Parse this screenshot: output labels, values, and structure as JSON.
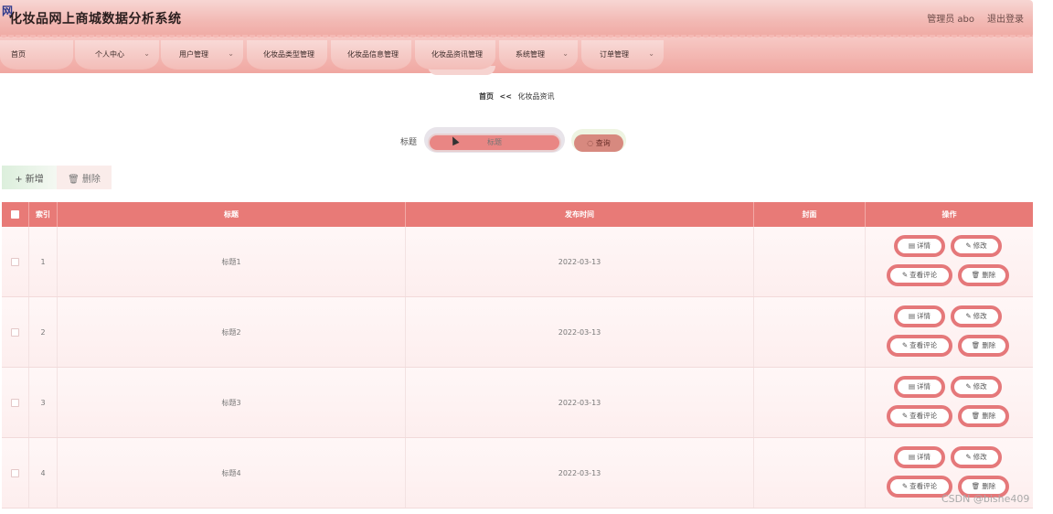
{
  "app": {
    "logo_glyph": "网",
    "title": "化妆品网上商城数据分析系统",
    "user_label": "管理员 abo",
    "logout_label": "退出登录"
  },
  "nav": {
    "items": [
      {
        "label": "首页",
        "has_dropdown": false
      },
      {
        "label": "个人中心",
        "has_dropdown": true
      },
      {
        "label": "用户管理",
        "has_dropdown": true
      },
      {
        "label": "化妆品类型管理",
        "has_dropdown": false
      },
      {
        "label": "化妆品信息管理",
        "has_dropdown": false
      },
      {
        "label": "化妆品资讯管理",
        "has_dropdown": false,
        "active": true
      },
      {
        "label": "系统管理",
        "has_dropdown": true
      },
      {
        "label": "订单管理",
        "has_dropdown": true
      }
    ],
    "dropdown_glyph": "⌄"
  },
  "breadcrumb": {
    "home": "首页",
    "separator": "<<",
    "current": "化妆品资讯"
  },
  "search": {
    "label": "标题",
    "placeholder": "标题",
    "value": "",
    "button_label": "◌ 查询"
  },
  "toolbar": {
    "add_label": "+ 新增",
    "delete_label": "🗑 删除"
  },
  "table": {
    "headers": [
      "",
      "索引",
      "标题",
      "发布时间",
      "封面",
      "操作"
    ],
    "rows": [
      {
        "index": "1",
        "title": "标题1",
        "date": "2022-03-13",
        "cover": ""
      },
      {
        "index": "2",
        "title": "标题2",
        "date": "2022-03-13",
        "cover": ""
      },
      {
        "index": "3",
        "title": "标题3",
        "date": "2022-03-13",
        "cover": ""
      },
      {
        "index": "4",
        "title": "标题4",
        "date": "2022-03-13",
        "cover": ""
      }
    ],
    "actions": {
      "detail": "详情",
      "edit": "修改",
      "comments": "查看评论",
      "remove": "删除"
    }
  },
  "watermark": "CSDN @bishe409",
  "colors": {
    "accent": "#e87a77",
    "header_bg": "#f2b8b3",
    "search_input_bg": "#e98684",
    "query_btn_bg": "#d7897f",
    "op_border": "#e5787a"
  }
}
